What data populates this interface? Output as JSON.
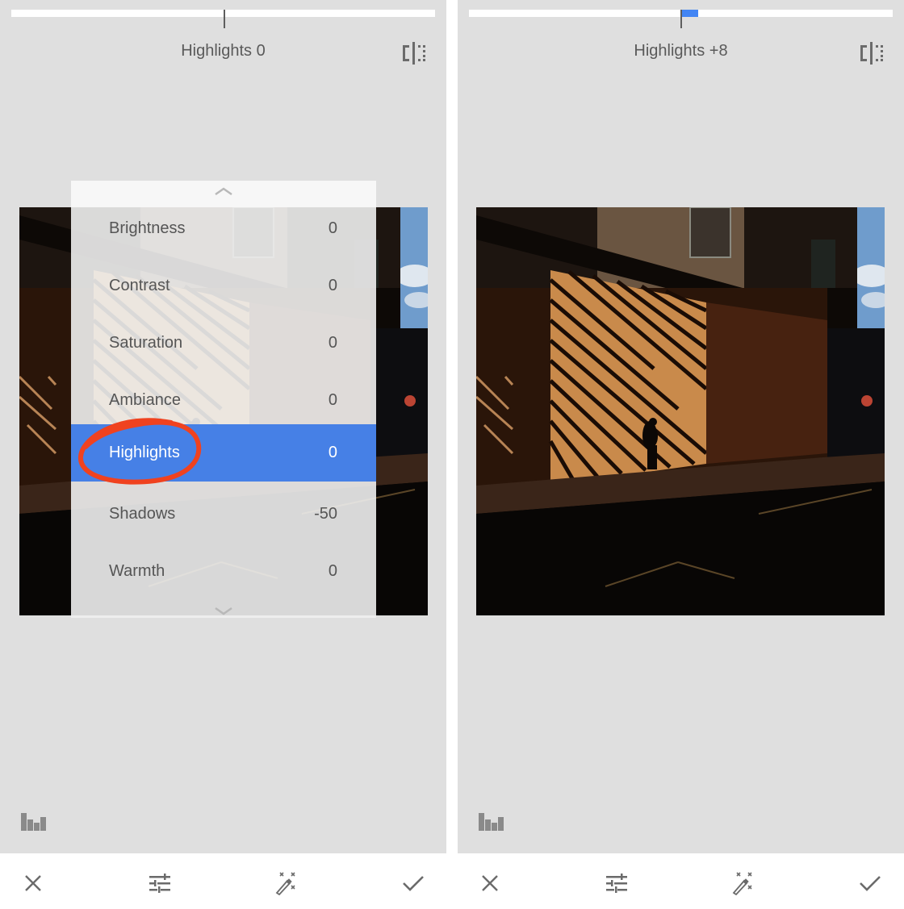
{
  "colors": {
    "background": "#dfdfdf",
    "accent": "#4285f4",
    "selected_row": "#4680e6",
    "annotation": "#f0421f",
    "icon": "#6b6b6b",
    "text": "#5a5a5a"
  },
  "left_panel": {
    "param_label": "Highlights 0",
    "slider": {
      "value": 0,
      "min": -100,
      "max": 100
    },
    "compare_icon": "compare-split-icon",
    "histogram_icon": "histogram-icon",
    "menu": {
      "scroll_up_icon": "chevron-up-icon",
      "scroll_down_icon": "chevron-down-icon",
      "items": [
        {
          "label": "Brightness",
          "value": "0"
        },
        {
          "label": "Contrast",
          "value": "0"
        },
        {
          "label": "Saturation",
          "value": "0"
        },
        {
          "label": "Ambiance",
          "value": "0"
        },
        {
          "label": "Highlights",
          "value": "0",
          "selected": true
        },
        {
          "label": "Shadows",
          "value": "-50"
        },
        {
          "label": "Warmth",
          "value": "0"
        }
      ]
    },
    "toolbar": [
      {
        "name": "cancel",
        "icon": "close-icon"
      },
      {
        "name": "adjust",
        "icon": "sliders-icon"
      },
      {
        "name": "auto",
        "icon": "magic-wand-icon"
      },
      {
        "name": "apply",
        "icon": "checkmark-icon"
      }
    ]
  },
  "right_panel": {
    "param_label": "Highlights +8",
    "slider": {
      "value": 8,
      "min": -100,
      "max": 100
    },
    "compare_icon": "compare-split-icon",
    "histogram_icon": "histogram-icon",
    "toolbar": [
      {
        "name": "cancel",
        "icon": "close-icon"
      },
      {
        "name": "adjust",
        "icon": "sliders-icon"
      },
      {
        "name": "auto",
        "icon": "magic-wand-icon"
      },
      {
        "name": "apply",
        "icon": "checkmark-icon"
      }
    ]
  }
}
